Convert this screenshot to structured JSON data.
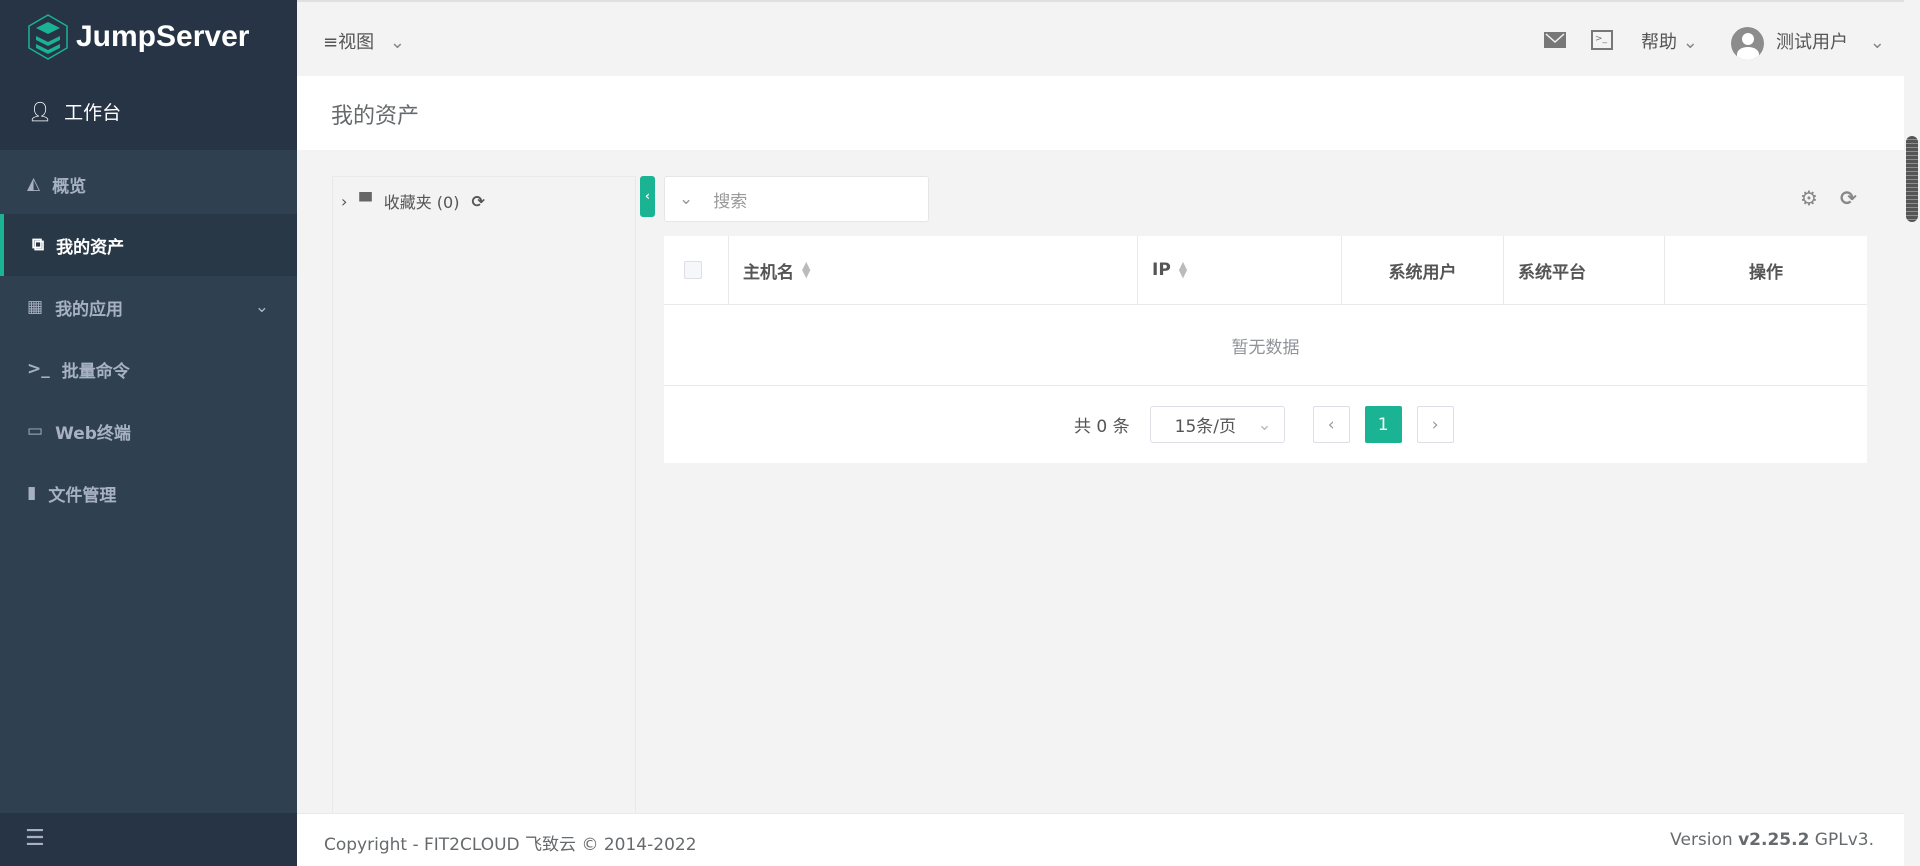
{
  "app": {
    "name": "JumpServer",
    "brand_color": "#1ab394"
  },
  "sidebar": {
    "workbench": "工作台",
    "items": [
      {
        "label": "概览",
        "icon": "area-chart-icon"
      },
      {
        "label": "我的资产",
        "icon": "clone-icon",
        "active": true
      },
      {
        "label": "我的应用",
        "icon": "grid-icon"
      },
      {
        "label": "批量命令",
        "icon": "terminal-icon"
      },
      {
        "label": "Web终端",
        "icon": "window-icon"
      },
      {
        "label": "文件管理",
        "icon": "file-icon"
      }
    ]
  },
  "topbar": {
    "view": "视图",
    "help": "帮助",
    "user": "测试用户"
  },
  "page": {
    "title": "我的资产"
  },
  "tree": {
    "favorites": "收藏夹 (0)"
  },
  "search": {
    "placeholder": "搜索"
  },
  "table": {
    "columns": [
      "主机名",
      "IP",
      "系统用户",
      "系统平台",
      "操作"
    ],
    "empty": "暂无数据"
  },
  "pagination": {
    "total": "共 0 条",
    "page_size": "15条/页",
    "current": "1"
  },
  "footer": {
    "copyright": "Copyright - FIT2CLOUD 飞致云 © 2014-2022",
    "version_prefix": "Version ",
    "version": "v2.25.2",
    "license": " GPLv3."
  }
}
